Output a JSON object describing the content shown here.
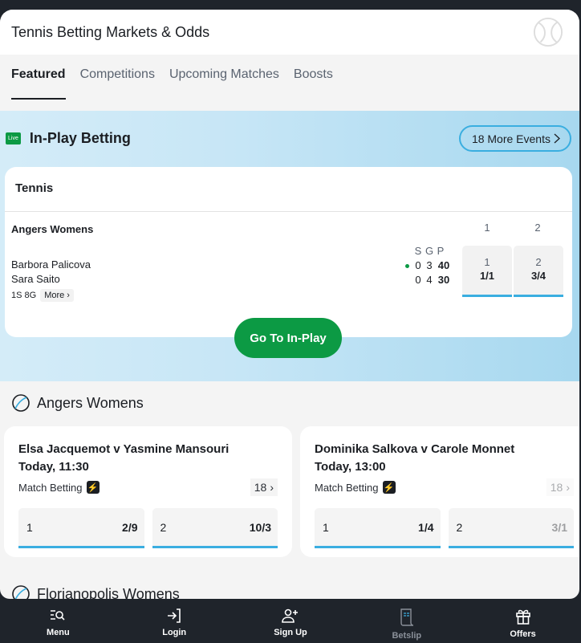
{
  "header": {
    "title": "Tennis Betting Markets & Odds",
    "logo_icon": "tennis-ball-icon"
  },
  "tabs": [
    {
      "label": "Featured",
      "active": true
    },
    {
      "label": "Competitions",
      "active": false
    },
    {
      "label": "Upcoming Matches",
      "active": false
    },
    {
      "label": "Boosts",
      "active": false
    }
  ],
  "inplay": {
    "badge": "Live",
    "title": "In-Play Betting",
    "more_events": "18 More Events",
    "card_title": "Tennis",
    "competition": "Angers Womens",
    "col_headers": [
      "1",
      "2"
    ],
    "score_headers": [
      "S",
      "G",
      "P"
    ],
    "players": [
      {
        "name": "Barbora Palicova",
        "sets": "0",
        "games": "3",
        "points": "40",
        "serving": true
      },
      {
        "name": "Sara Saito",
        "sets": "0",
        "games": "4",
        "points": "30",
        "serving": false
      }
    ],
    "stage": "1S 8G",
    "more_label": "More",
    "odds": [
      {
        "selection": "1",
        "price": "1/1"
      },
      {
        "selection": "2",
        "price": "3/4"
      }
    ],
    "cta": "Go To In-Play"
  },
  "competitions": [
    {
      "name": "Angers Womens",
      "matches": [
        {
          "title": "Elsa Jacquemot v Yasmine Mansouri",
          "time": "Today, 11:30",
          "market": "Match Betting",
          "count": "18",
          "odds": [
            {
              "selection": "1",
              "price": "2/9"
            },
            {
              "selection": "2",
              "price": "10/3"
            }
          ]
        },
        {
          "title": "Dominika Salkova v Carole Monnet",
          "time": "Today, 13:00",
          "market": "Match Betting",
          "count": "18",
          "odds": [
            {
              "selection": "1",
              "price": "1/4"
            },
            {
              "selection": "2",
              "price": "3/1"
            }
          ]
        }
      ]
    },
    {
      "name": "Florianopolis Womens"
    }
  ],
  "bottom_nav": [
    {
      "label": "Menu",
      "icon": "menu-search-icon"
    },
    {
      "label": "Login",
      "icon": "login-icon"
    },
    {
      "label": "Sign Up",
      "icon": "add-user-icon"
    },
    {
      "label": "Betslip",
      "icon": "betslip-icon",
      "disabled": true
    },
    {
      "label": "Offers",
      "icon": "gift-icon"
    }
  ],
  "colors": {
    "accent_green": "#0c9a44",
    "accent_blue": "#3aaee0",
    "dark": "#1f242b"
  }
}
